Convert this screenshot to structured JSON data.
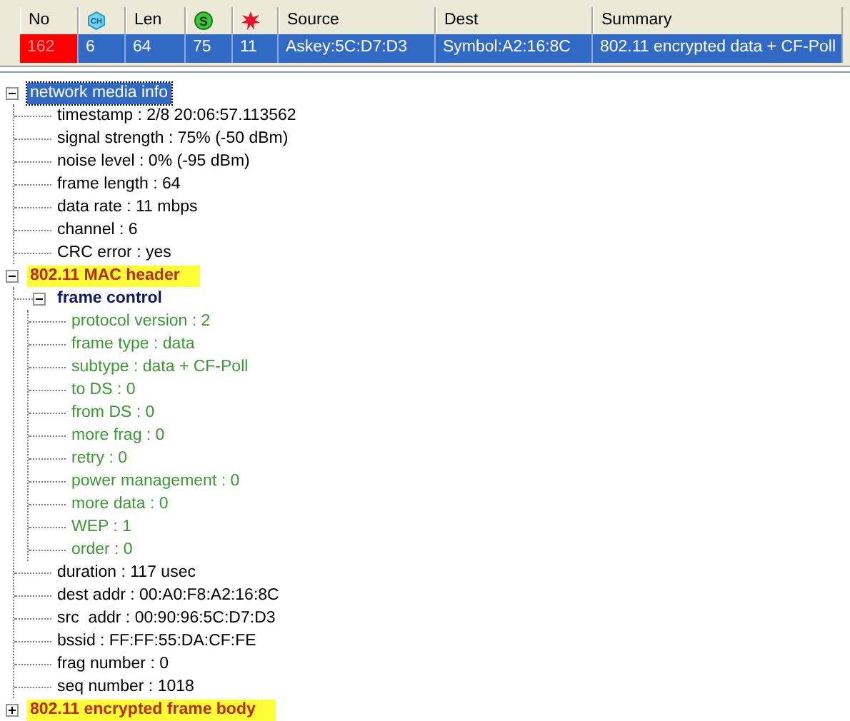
{
  "packet_list": {
    "columns": [
      {
        "kind": "text",
        "label": "No"
      },
      {
        "kind": "channel",
        "label": "CH"
      },
      {
        "kind": "text",
        "label": "Len"
      },
      {
        "kind": "signal",
        "label": "S"
      },
      {
        "kind": "burst"
      },
      {
        "kind": "text",
        "label": "Source"
      },
      {
        "kind": "text",
        "label": "Dest"
      },
      {
        "kind": "text",
        "label": "Summary"
      }
    ],
    "rows": [
      {
        "selected": true,
        "color": "#ff0000",
        "cells": [
          "162",
          "6",
          "64",
          "75",
          "11",
          "Askey:5C:D7:D3",
          "Symbol:A2:16:8C",
          "802.11 encrypted data + CF-Poll"
        ]
      }
    ]
  },
  "tree": [
    {
      "kind": "section",
      "label": "network media info",
      "selected": true,
      "expanded": true,
      "children": [
        {
          "kind": "field",
          "label": "timestamp : 2/8 20:06:57.113562",
          "selected": false
        },
        {
          "kind": "field",
          "label": "signal strength : 75% (-50 dBm)",
          "selected": false
        },
        {
          "kind": "field",
          "label": "noise level : 0% (-95 dBm)",
          "selected": false
        },
        {
          "kind": "field",
          "label": "frame length : 64",
          "selected": false
        },
        {
          "kind": "field",
          "label": "data rate : 11 mbps",
          "selected": false
        },
        {
          "kind": "field",
          "label": "channel : 6",
          "selected": false
        },
        {
          "kind": "field",
          "label": "CRC error : yes",
          "selected": false
        }
      ]
    },
    {
      "kind": "header",
      "label": "802.11 MAC header",
      "selected": false,
      "expanded": true,
      "children": [
        {
          "kind": "group",
          "label": "frame control",
          "selected": false,
          "expanded": true,
          "children": [
            {
              "kind": "flag",
              "label": "protocol version : 2",
              "selected": false
            },
            {
              "kind": "flag",
              "label": "frame type : data",
              "selected": false
            },
            {
              "kind": "flag",
              "label": "subtype : data + CF-Poll",
              "selected": false
            },
            {
              "kind": "flag",
              "label": "to DS : 0",
              "selected": false
            },
            {
              "kind": "flag",
              "label": "from DS : 0",
              "selected": false
            },
            {
              "kind": "flag",
              "label": "more frag : 0",
              "selected": false
            },
            {
              "kind": "flag",
              "label": "retry : 0",
              "selected": false
            },
            {
              "kind": "flag",
              "label": "power management : 0",
              "selected": false
            },
            {
              "kind": "flag",
              "label": "more data : 0",
              "selected": false
            },
            {
              "kind": "flag",
              "label": "WEP : 1",
              "selected": false
            },
            {
              "kind": "flag",
              "label": "order : 0",
              "selected": false
            }
          ]
        },
        {
          "kind": "field",
          "label": "duration : 117 usec",
          "selected": false
        },
        {
          "kind": "field",
          "label": "dest addr : 00:A0:F8:A2:16:8C",
          "selected": false
        },
        {
          "kind": "field",
          "label": "src  addr : 00:90:96:5C:D7:D3",
          "selected": false
        },
        {
          "kind": "field",
          "label": "bssid : FF:FF:55:DA:CF:FE",
          "selected": false
        },
        {
          "kind": "field",
          "label": "frag number : 0",
          "selected": false
        },
        {
          "kind": "field",
          "label": "seq number : 1018",
          "selected": false
        }
      ]
    },
    {
      "kind": "header",
      "label": "802.11 encrypted frame body",
      "selected": false,
      "expanded": false
    }
  ]
}
